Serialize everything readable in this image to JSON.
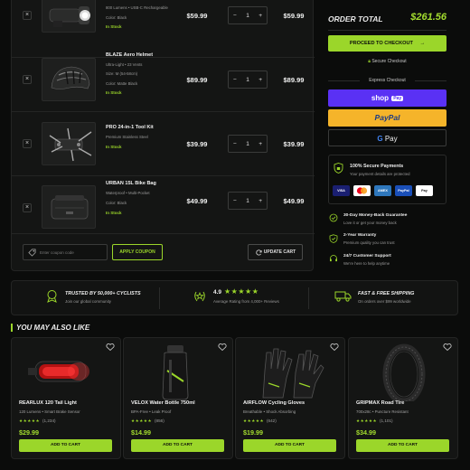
{
  "cart": {
    "items": [
      {
        "name": "",
        "lines": [
          "800 Lumens • USB-C Rechargeable",
          "Color: Black"
        ],
        "stock": "In Stock",
        "price": "$59.99",
        "qty": "1",
        "total": "$59.99",
        "image_icon": "bike-headlight-icon"
      },
      {
        "name": "BLAZE Aero Helmet",
        "lines": [
          "Ultra-Light • 23 Vents",
          "Size: M (54-58cm)",
          "Color: Matte Black"
        ],
        "stock": "In Stock",
        "price": "$89.99",
        "qty": "1",
        "total": "$89.99",
        "image_icon": "helmet-icon"
      },
      {
        "name": "PRO 24-in-1 Tool Kit",
        "lines": [
          "Premium Stainless Steel"
        ],
        "stock": "In Stock",
        "price": "$39.99",
        "qty": "1",
        "total": "$39.99",
        "image_icon": "multitool-icon"
      },
      {
        "name": "URBAN 15L Bike Bag",
        "lines": [
          "Waterproof • Multi-Pocket",
          "Color: Black"
        ],
        "stock": "In Stock",
        "price": "$49.99",
        "qty": "1",
        "total": "$49.99",
        "image_icon": "bike-bag-icon"
      }
    ],
    "remove_glyph": "×",
    "minus_glyph": "−",
    "plus_glyph": "+",
    "coupon_placeholder": "Enter coupon code",
    "apply_coupon": "APPLY COUPON",
    "update_cart": "UPDATE CART"
  },
  "summary": {
    "order_total_label": "ORDER TOTAL",
    "order_total_value": "$261.56",
    "checkout": "PROCEED TO CHECKOUT",
    "secure_checkout": "Secure Checkout",
    "express_checkout": "Express Checkout",
    "shop_pay": "shop",
    "shop_pay_badge": "Pay",
    "paypal": "PayPal",
    "gpay": "Pay",
    "secure_title": "100% Secure Payments",
    "secure_sub": "Your payment details are protected",
    "cards": [
      "VISA",
      "MC",
      "AMEX",
      "PayPal",
      "Pay"
    ],
    "features": [
      {
        "title": "30-Day Money-Back Guarantee",
        "sub": "Love it or get your money back",
        "icon": "guarantee-icon"
      },
      {
        "title": "2-Year Warranty",
        "sub": "Premium quality you can trust",
        "icon": "shield-check-icon"
      },
      {
        "title": "24/7 Customer Support",
        "sub": "We're here to help anytime",
        "icon": "headset-icon"
      }
    ]
  },
  "trust": {
    "cyclists_title": "TRUSTED BY 50,000+ CYCLISTS",
    "cyclists_sub": "Join our global community",
    "rating_value": "4.9",
    "rating_stars": "★★★★★",
    "rating_sub": "Average Rating from 4,000+ Reviews",
    "shipping_title": "FAST & FREE SHIPPING",
    "shipping_sub": "On orders over $99 worldwide"
  },
  "recommend": {
    "heading": "YOU MAY ALSO LIKE",
    "products": [
      {
        "name": "REARLUX 120 Tail Light",
        "desc": "120 Lumens • Smart Brake Sensor",
        "stars": "★★★★★",
        "reviews": "(1,234)",
        "price": "$29.99",
        "cta": "ADD TO CART",
        "icon": "tail-light-icon"
      },
      {
        "name": "VELOX Water Bottle 750ml",
        "desc": "BPA-Free • Leak Proof",
        "stars": "★★★★★",
        "reviews": "(856)",
        "price": "$14.99",
        "cta": "ADD TO CART",
        "icon": "water-bottle-icon"
      },
      {
        "name": "AIRFLOW Cycling Gloves",
        "desc": "Breathable • Shock Absorbing",
        "stars": "★★★★★",
        "reviews": "(642)",
        "price": "$19.99",
        "cta": "ADD TO CART",
        "icon": "gloves-icon"
      },
      {
        "name": "GRIPMAX Road Tire",
        "desc": "700x28c • Puncture Resistant",
        "stars": "★★★★★",
        "reviews": "(1,101)",
        "price": "$34.99",
        "cta": "ADD TO CART",
        "icon": "tire-icon"
      }
    ]
  },
  "colors": {
    "accent": "#9bd62a",
    "background": "#0b0c0b",
    "panel": "#141514",
    "shop_pay": "#5a31f4",
    "paypal": "#f5b42a"
  }
}
